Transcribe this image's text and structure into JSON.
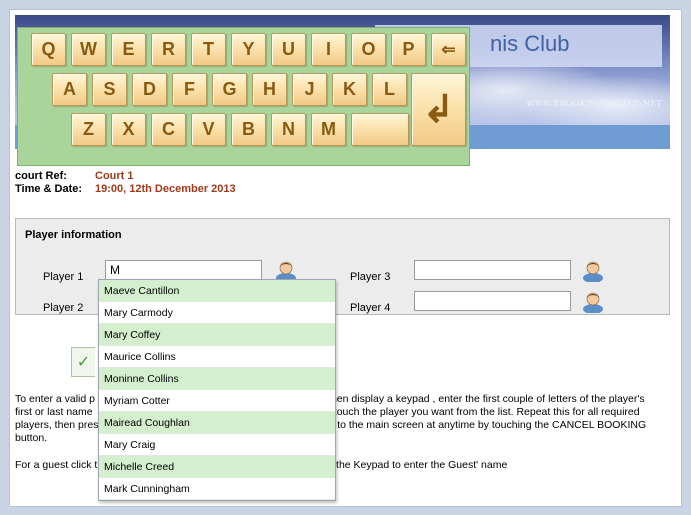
{
  "header": {
    "club_name_visible": "nis Club",
    "website": "WWW.EBOOKINGONLINE.NET"
  },
  "keyboard": {
    "rows": [
      [
        "Q",
        "W",
        "E",
        "R",
        "T",
        "Y",
        "U",
        "I",
        "O",
        "P"
      ],
      [
        "A",
        "S",
        "D",
        "F",
        "G",
        "H",
        "J",
        "K",
        "L"
      ],
      [
        "Z",
        "X",
        "C",
        "V",
        "B",
        "N",
        "M"
      ]
    ],
    "backspace_glyph": "⇐",
    "space_label": "",
    "enter_glyph": "↲"
  },
  "booking": {
    "court_ref_label": "court Ref:",
    "court_ref_value": "Court 1",
    "time_date_label": "Time & Date:",
    "time_date_value": "19:00, 12th December 2013"
  },
  "player_info": {
    "title": "Player information",
    "player1_label": "Player 1",
    "player1_value": "M",
    "player2_label": "Player 2",
    "player3_label": "Player 3",
    "player3_value": "",
    "player4_label": "Player 4",
    "player4_value": ""
  },
  "done_glyph": "✓",
  "autocomplete": {
    "items": [
      "Maeve Cantillon",
      "Mary Carmody",
      "Mary Coffey",
      "Maurice Collins",
      "Moninne Collins",
      "Myriam Cotter",
      "Mairead Coughlan",
      "Mary Craig",
      "Michelle Creed",
      "Mark Cunningham"
    ]
  },
  "help": {
    "line1_left": "To enter a valid p",
    "line1_right": "hen display a keypad , enter the first couple of letters of the player's",
    "line2_left": "first or last name",
    "line2_right": "y touch the player you want from the list. Repeat this for all required",
    "line3_left": "players, then pres",
    "line3_right": "n to the main screen at anytime by touching the CANCEL BOOKING",
    "line4": "button.",
    "line5_left": "For a guest click t",
    "line5_right": "e the Keypad to enter the Guest' name"
  },
  "colors": {
    "key_face": "#fbe3ad",
    "key_text": "#8a5a12",
    "keyboard_bg": "#a9d59a",
    "accent_value": "#a03a1a",
    "dropdown_alt_row": "#d3efcd",
    "header_bar": "#6f9dd3"
  }
}
